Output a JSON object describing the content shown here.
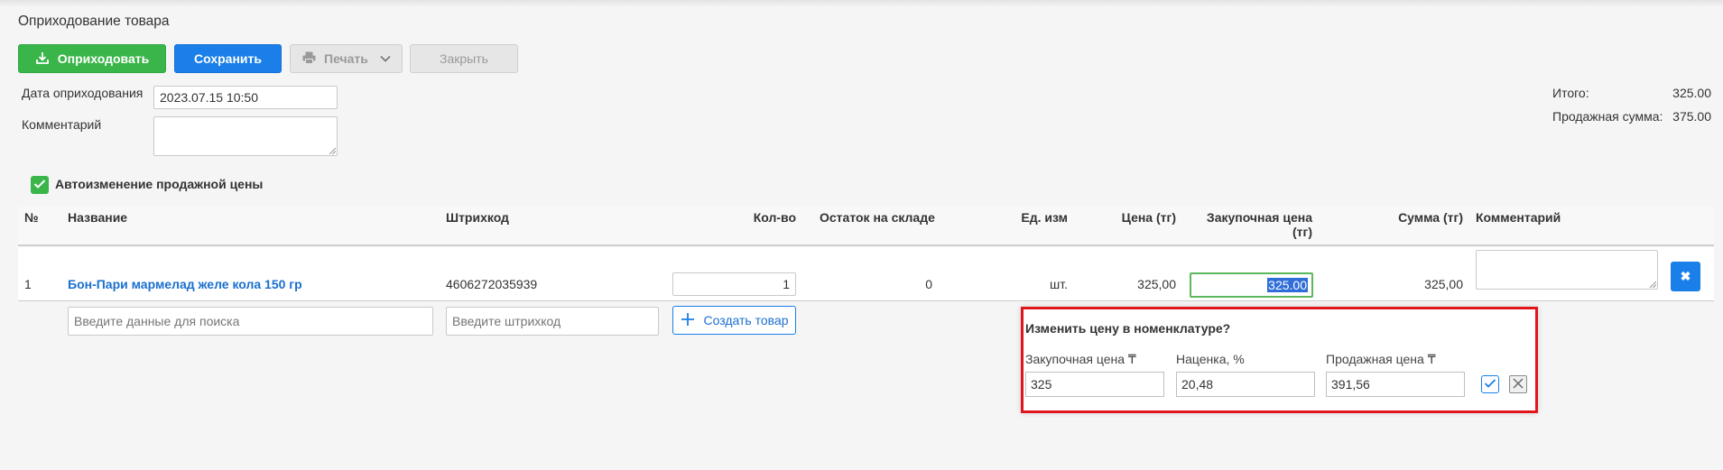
{
  "page": {
    "title": "Оприходование товара"
  },
  "toolbar": {
    "post_label": "Оприходовать",
    "save_label": "Сохранить",
    "print_label": "Печать",
    "close_label": "Закрыть"
  },
  "form": {
    "date_label": "Дата оприходования",
    "date_value": "2023.07.15 10:50",
    "comment_label": "Комментарий",
    "comment_value": ""
  },
  "totals": {
    "total_label": "Итого:",
    "total_value": "325.00",
    "sale_label": "Продажная сумма:",
    "sale_value": "375.00"
  },
  "auto_price": {
    "label": "Автоизменение продажной цены",
    "checked": true
  },
  "table": {
    "headers": {
      "num": "№",
      "name": "Название",
      "barcode": "Штрихкод",
      "qty": "Кол-во",
      "stock": "Остаток на складе",
      "unit": "Ед. изм",
      "price": "Цена (тг)",
      "purchase_line1": "Закупочная цена",
      "purchase_line2": "(тг)",
      "sum": "Сумма (тг)",
      "comment": "Комментарий"
    },
    "rows": [
      {
        "num": "1",
        "name": "Бон-Пари мармелад желе кола 150 гр",
        "barcode": "4606272035939",
        "qty": "1",
        "stock": "0",
        "unit": "шт.",
        "price": "325,00",
        "purchase": "325.00",
        "sum": "325,00",
        "comment": ""
      }
    ]
  },
  "search": {
    "name_placeholder": "Введите данные для поиска",
    "barcode_placeholder": "Введите штрихкод",
    "create_label": "Создать товар"
  },
  "popup": {
    "title": "Изменить цену в номенклатуре?",
    "purchase_label": "Закупочная цена ₸",
    "purchase_value": "325",
    "markup_label": "Наценка, %",
    "markup_value": "20,48",
    "sale_label": "Продажная цена ₸",
    "sale_value": "391,56"
  },
  "colors": {
    "green": "#39b54a",
    "blue": "#1a7fe8",
    "link": "#1a6fcf",
    "highlight_border": "#e0161c"
  }
}
